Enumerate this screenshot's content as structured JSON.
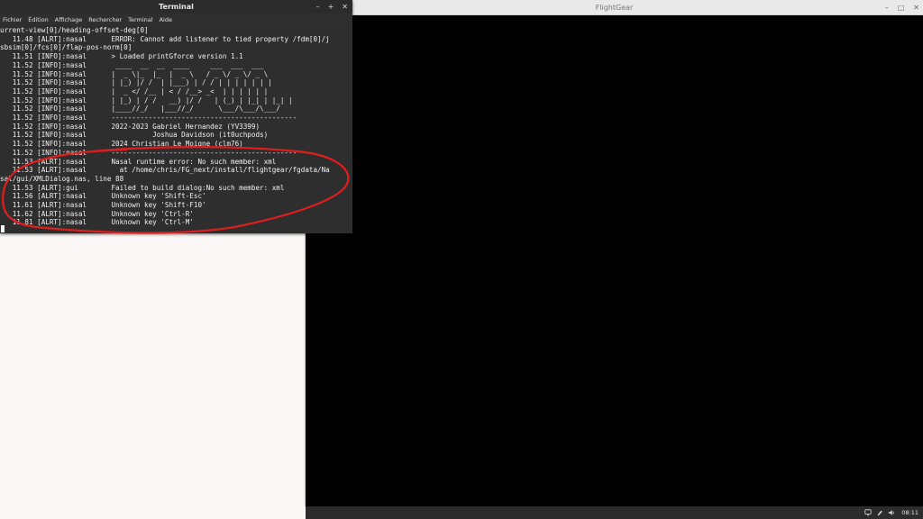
{
  "flightgear_window": {
    "title": "FlightGear",
    "controls": [
      "–",
      "□",
      "✕"
    ]
  },
  "terminal": {
    "title": "Terminal",
    "controls": [
      "–",
      "+",
      "✕"
    ],
    "menu": [
      "Fichier",
      "Édition",
      "Affichage",
      "Rechercher",
      "Terminal",
      "Aide"
    ],
    "lines": [
      "urrent-view[0]/heading-offset-deg[0]",
      "   11.48 [ALRT]:nasal      ERROR: Cannot add listener to tied property /fdm[0]/j",
      "sbsim[0]/fcs[0]/flap-pos-norm[0]",
      "   11.51 [INFO]:nasal      > Loaded printGforce version 1.1",
      "   11.52 [INFO]:nasal       ____  __  __  ____     ___  ___  ___",
      "   11.52 [INFO]:nasal      |  _ \\|_  |_  |  _ \\   / _ \\/ _ \\/ _ \\",
      "   11.52 [INFO]:nasal      | |_) |/ /  | |___) | / / | | | | | | |",
      "   11.52 [INFO]:nasal      |  _ </ /__ | < / /__> _<  | | | | | |",
      "   11.52 [INFO]:nasal      | |_) | / /   __) |/ /   | (_) | |_| | |_| |",
      "   11.52 [INFO]:nasal      |____//_/   |___//_/      \\___/\\___/\\___/",
      "   11.52 [INFO]:nasal      ---------------------------------------------",
      "   11.52 [INFO]:nasal      2022-2023 Gabriel Hernandez (YV3399)",
      "   11.52 [INFO]:nasal                Joshua Davidson (it0uchpods)",
      "   11.52 [INFO]:nasal      2024 Christian Le Moigne (clm76)",
      "   11.52 [INFO]:nasal      ---------------------------------------------",
      "   11.53 [ALRT]:nasal      Nasal runtime error: No such member: xml",
      "   11.53 [ALRT]:nasal        at /home/chris/FG_next/install/flightgear/fgdata/Na",
      "sal/gui/XMLDialog.nas, line 88",
      "   11.53 [ALRT]:gui        Failed to build dialog:No such member: xml",
      "   11.56 [ALRT]:nasal      Unknown key 'Shift-Esc'",
      "   11.61 [ALRT]:nasal      Unknown key 'Shift-F10'",
      "   11.62 [ALRT]:nasal      Unknown key 'Ctrl-R'",
      "   11.81 [ALRT]:nasal      Unknown key 'Ctrl-M'"
    ]
  },
  "annotation_color": "#e01e1e",
  "taskbar": {
    "tray_icons": [
      "network-icon",
      "pen-icon",
      "volume-icon"
    ],
    "clock": "08:11"
  }
}
